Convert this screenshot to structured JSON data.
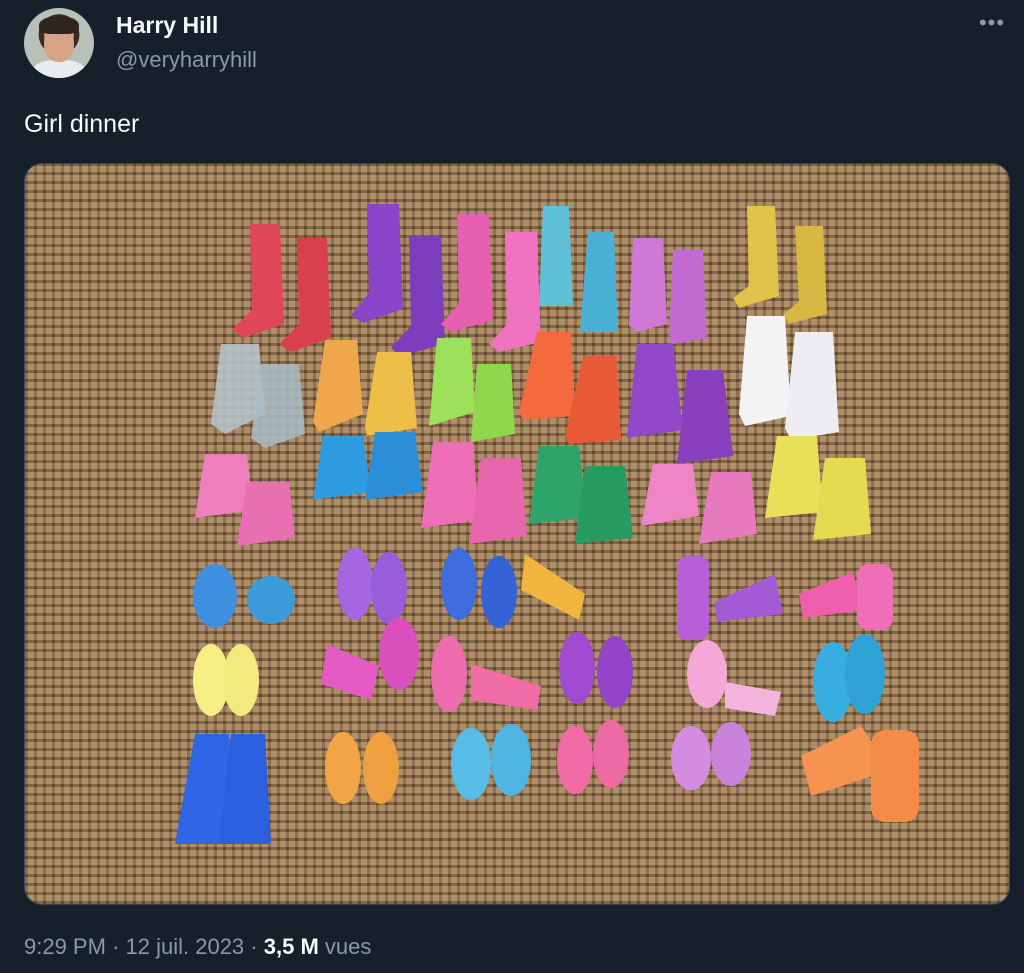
{
  "author": {
    "name": "Harry Hill",
    "handle": "@veryharryhill"
  },
  "tweet": {
    "text": "Girl dinner"
  },
  "meta": {
    "time": "9:29 PM",
    "separator1": "·",
    "date": "12 juil. 2023",
    "separator2": "·",
    "views_count": "3,5 M",
    "views_label": "vues"
  },
  "icons": {
    "more": "more-horizontal-icon"
  },
  "colors": {
    "background": "#15202b",
    "secondary_text": "#8b98a5",
    "primary_text": "#f7f9f9",
    "burlap": "#9c7a55"
  }
}
